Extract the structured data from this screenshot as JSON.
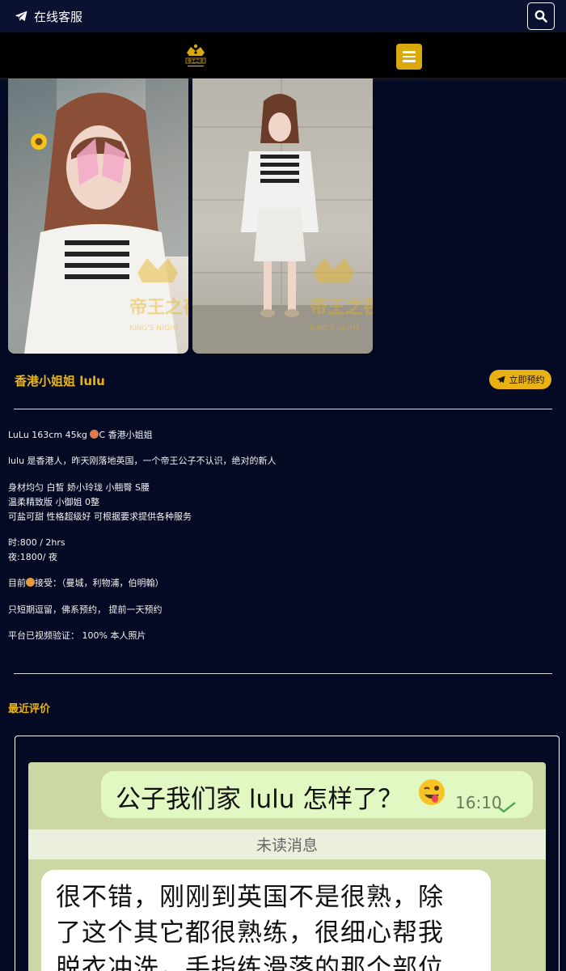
{
  "topbar": {
    "service_label": "在线客服"
  },
  "header": {
    "logo_text": "帝王之夜"
  },
  "photos": {
    "watermark_main": "帝王之夜",
    "watermark_sub": "KING'S NIGHT"
  },
  "profile": {
    "title": "香港小姐姐 lulu",
    "book_label": "立即预约",
    "lines": {
      "l1_pre": "LuLu 163cm 45kg ",
      "l1_post": "C 香港小姐姐",
      "l2": "lulu 是香港人，昨天刚落地英国，一个帝王公子不认识，绝对的新人",
      "l3": "身材均匀 白皙 娇小玲珑 小翹臀 S腰",
      "l4": "温柔精致版 小御姐 0整",
      "l5": "可盐可甜 性格超级好 可根据要求提供各种服务",
      "l6": "时:800 / 2hrs",
      "l7": "夜:1800/ 夜",
      "l8_pre": "目前",
      "l8_post": "接受：（曼城，利物浦，伯明翰）",
      "l9": "只短期逗留，佛系预约， 提前一天预约",
      "l10": "平台已视频验证： 100% 本人照片"
    }
  },
  "reviews": {
    "title": "最近评价",
    "chat": {
      "outgoing": "公子我们家 lulu 怎样了？",
      "time": "16:10",
      "unread": "未读消息",
      "incoming_1": "很不错，刚刚到英国不是很熟，除",
      "incoming_2": "了这个其它都很熟练，很细心帮我",
      "incoming_3": "脱衣冲洗，手指练滑落的那个部位"
    }
  },
  "colors": {
    "background": "#050a24",
    "gold": "#e7b41c",
    "menu_button": "#d9a90f"
  },
  "icons": [
    "telegram-icon",
    "search-icon",
    "menu-icon",
    "crown-logo-icon"
  ]
}
